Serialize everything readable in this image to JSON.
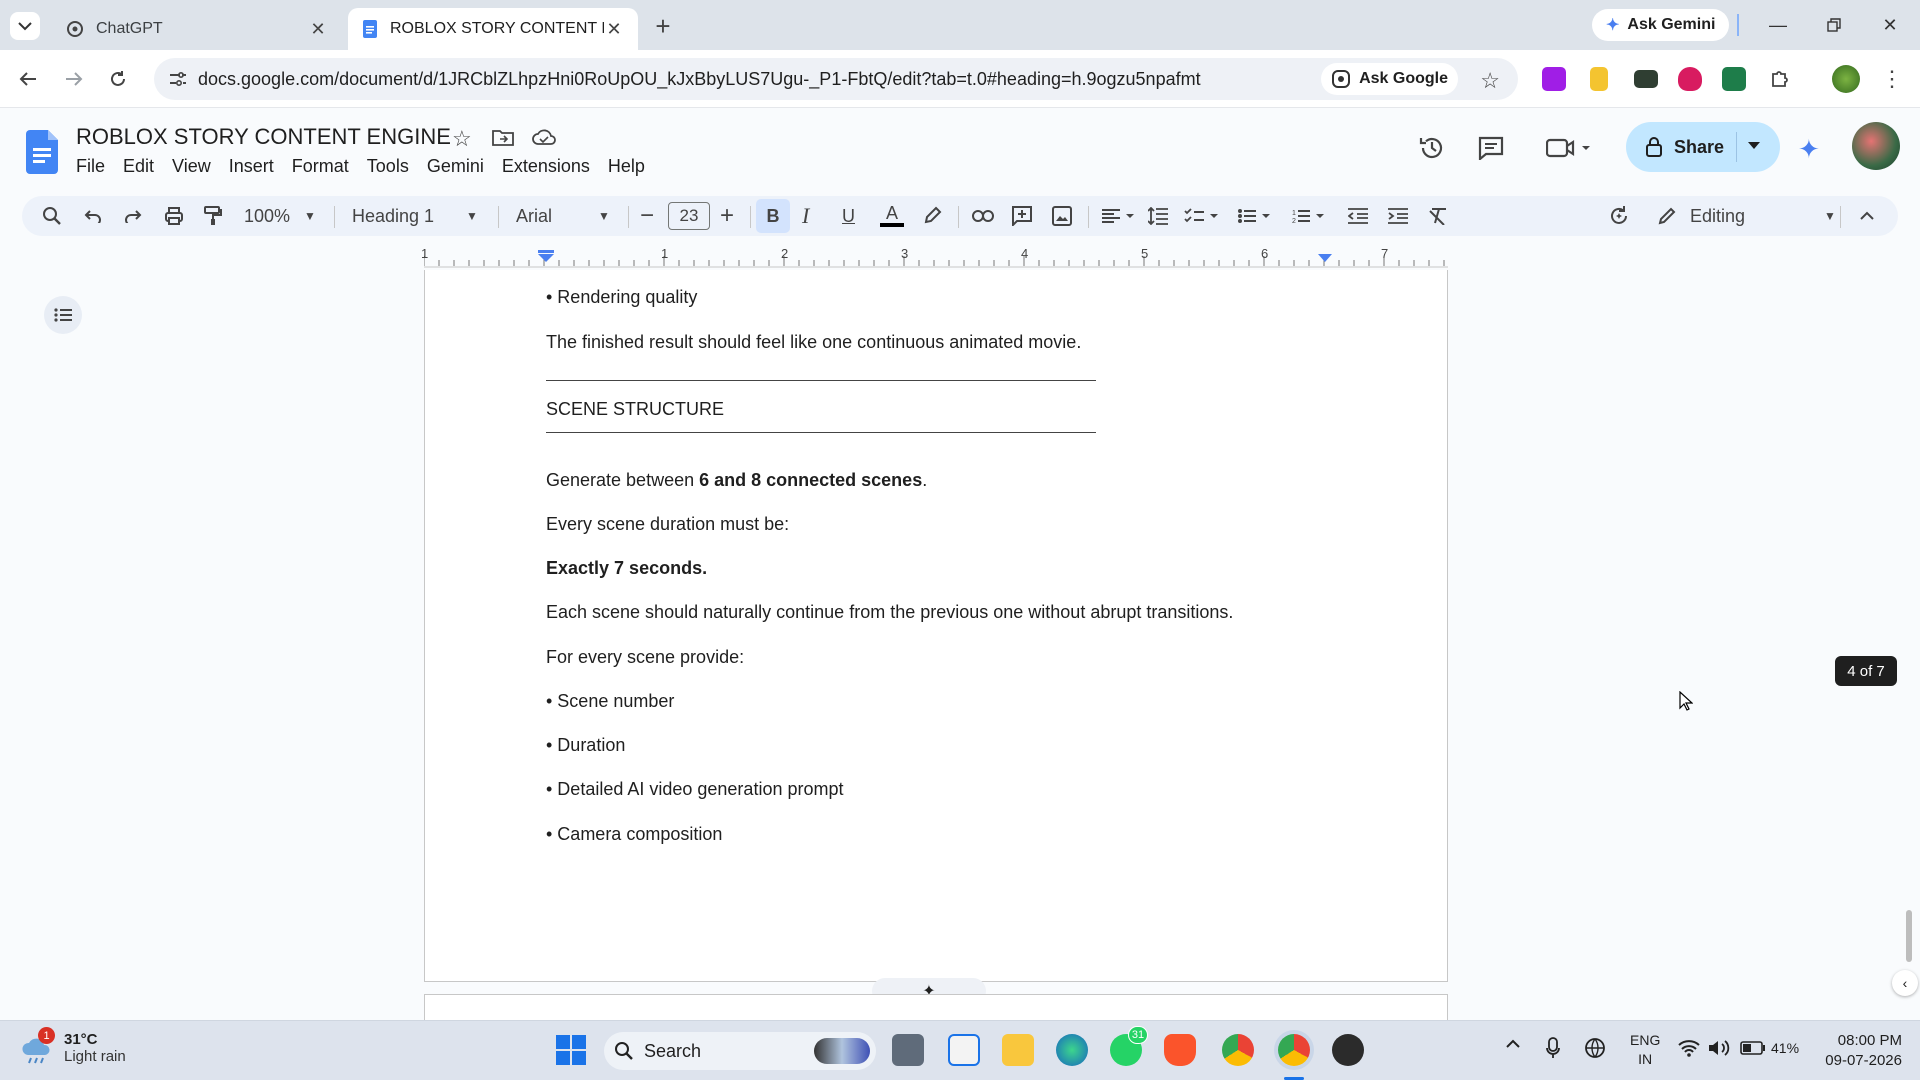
{
  "browser": {
    "tabs": [
      {
        "title": "ChatGPT",
        "active": false
      },
      {
        "title": "ROBLOX STORY CONTENT ENG",
        "active": true
      }
    ],
    "ask_gemini": "Ask Gemini",
    "url": "docs.google.com/document/d/1JRCblZLhpzHni0RoUpOU_kJxBbyLUS7Ugu-_P1-FbtQ/edit?tab=t.0#heading=h.9ogzu5npafmt",
    "ask_google": "Ask Google"
  },
  "docs": {
    "title": "ROBLOX STORY CONTENT ENGINE",
    "menu": [
      "File",
      "Edit",
      "View",
      "Insert",
      "Format",
      "Tools",
      "Gemini",
      "Extensions",
      "Help"
    ],
    "share_label": "Share",
    "toolbar": {
      "zoom": "100%",
      "style": "Heading 1",
      "font": "Arial",
      "font_size": "23",
      "mode": "Editing"
    },
    "ruler_numbers": [
      "1",
      "1",
      "2",
      "3",
      "4",
      "5",
      "6",
      "7"
    ]
  },
  "document": {
    "lines": [
      {
        "text": "• Rendering quality"
      },
      {
        "text": "The finished result should feel like one continuous animated movie."
      },
      {
        "text": "SCENE STRUCTURE"
      },
      {
        "pre": "Generate between ",
        "bold": "6 and 8 connected scenes",
        "post": "."
      },
      {
        "text": "Every scene duration must be:"
      },
      {
        "text": "Exactly 7 seconds."
      },
      {
        "text": "Each scene should naturally continue from the previous one without abrupt transitions."
      },
      {
        "text": "For every scene provide:"
      },
      {
        "text": "• Scene number"
      },
      {
        "text": "• Duration"
      },
      {
        "text": "• Detailed AI video generation prompt"
      },
      {
        "text": "• Camera composition"
      }
    ],
    "page_indicator": "4 of 7"
  },
  "taskbar": {
    "weather_temp": "31°C",
    "weather_desc": "Light rain",
    "weather_badge": "1",
    "search_label": "Search",
    "whatsapp_badge": "31",
    "lang_top": "ENG",
    "lang_bottom": "IN",
    "battery": "41%",
    "time": "08:00 PM",
    "date": "09-07-2026"
  }
}
